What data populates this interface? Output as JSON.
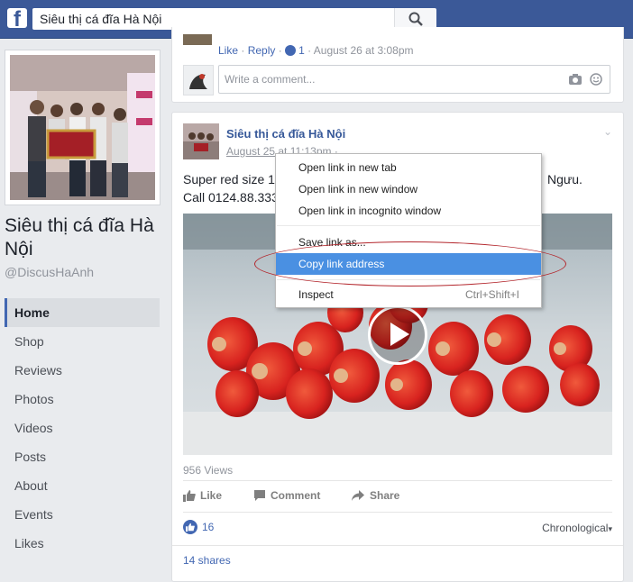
{
  "search": {
    "value": "Siêu thị cá đĩa Hà Nội"
  },
  "sidebar": {
    "page_name": "Siêu thị cá đĩa Hà Nội",
    "handle": "@DiscusHaAnh",
    "nav": [
      {
        "label": "Home",
        "active": true
      },
      {
        "label": "Shop"
      },
      {
        "label": "Reviews"
      },
      {
        "label": "Photos"
      },
      {
        "label": "Videos"
      },
      {
        "label": "Posts"
      },
      {
        "label": "About"
      },
      {
        "label": "Events"
      },
      {
        "label": "Likes"
      }
    ]
  },
  "comment": {
    "like": "Like",
    "reply": "Reply",
    "likes_count": "1",
    "time": "August 26 at 3:08pm",
    "sep": "·",
    "write_placeholder": "Write a comment..."
  },
  "post": {
    "author": "Siêu thị cá đĩa Hà Nội",
    "time": "August 25 at 11:13pm · ",
    "text_start": "Super red size 1",
    "text_end": "Ngưu.",
    "text_line2": "Call 0124.88.333",
    "views": "956 Views",
    "actions": {
      "like": "Like",
      "comment": "Comment",
      "share": "Share"
    },
    "likes": "16",
    "sort": "Chronological",
    "shares": "14 shares"
  },
  "context_menu": {
    "items": [
      {
        "label": "Open link in new tab"
      },
      {
        "label": "Open link in new window"
      },
      {
        "label": "Open link in incognito window"
      },
      {
        "label": "Save link as..."
      },
      {
        "label": "Copy link address",
        "highlighted": true
      },
      {
        "label": "Inspect",
        "shortcut": "Ctrl+Shift+I"
      }
    ]
  },
  "colors": {
    "facebook_blue": "#3b5998",
    "link_blue": "#4267b2",
    "menu_highlight": "#4a90e2",
    "annotation_red": "#b3262c"
  },
  "icons": [
    "facebook-logo-icon",
    "search-icon",
    "thumbs-up-icon",
    "camera-icon",
    "smiley-icon",
    "chevron-down-icon",
    "play-icon",
    "comment-icon",
    "share-icon"
  ]
}
